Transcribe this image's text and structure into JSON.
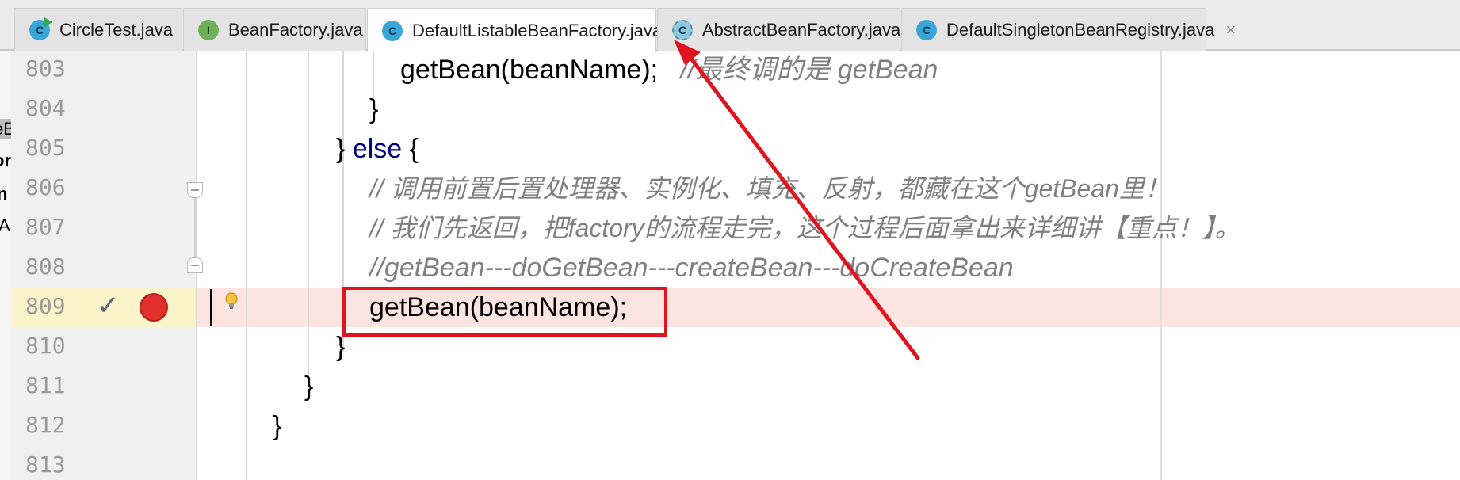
{
  "tabs": [
    {
      "label": "CircleTest.java",
      "icon": "C",
      "kind": "class-run"
    },
    {
      "label": "BeanFactory.java",
      "icon": "I",
      "kind": "interface"
    },
    {
      "label": "DefaultListableBeanFactory.java",
      "icon": "C",
      "kind": "class",
      "active": true
    },
    {
      "label": "AbstractBeanFactory.java",
      "icon": "C",
      "kind": "abstract-class"
    },
    {
      "label": "DefaultSingletonBeanRegistry.java",
      "icon": "C",
      "kind": "class"
    }
  ],
  "close_glyph": "×",
  "left_fragments": [
    "eB",
    "or",
    "n",
    "tA"
  ],
  "lines": {
    "l803": {
      "num": "803",
      "code": "getBean(beanName);",
      "comment": "//最终调的是 getBean"
    },
    "l804": {
      "num": "804",
      "code": "}"
    },
    "l805": {
      "num": "805",
      "brace": "}",
      "kw": "else",
      "rest": "{"
    },
    "l806": {
      "num": "806",
      "comment": "// 调用前置后置处理器、实例化、填充、反射，都藏在这个getBean里！"
    },
    "l807": {
      "num": "807",
      "comment": "// 我们先返回，把factory的流程走完，这个过程后面拿出来详细讲【重点！】。"
    },
    "l808": {
      "num": "808",
      "comment": "//getBean---doGetBean---createBean---doCreateBean"
    },
    "l809": {
      "num": "809",
      "code": "getBean(beanName);"
    },
    "l810": {
      "num": "810",
      "code": "}"
    },
    "l811": {
      "num": "811",
      "code": "}"
    },
    "l812": {
      "num": "812",
      "code": "}"
    },
    "l813": {
      "num": "813"
    }
  },
  "markers": {
    "check": "✓",
    "breakpoint_color": "#e0302c"
  },
  "colors": {
    "annotation_red": "#e0141f",
    "highlight_line": "#fce5e1",
    "keyword": "#000080",
    "comment": "#808080"
  }
}
